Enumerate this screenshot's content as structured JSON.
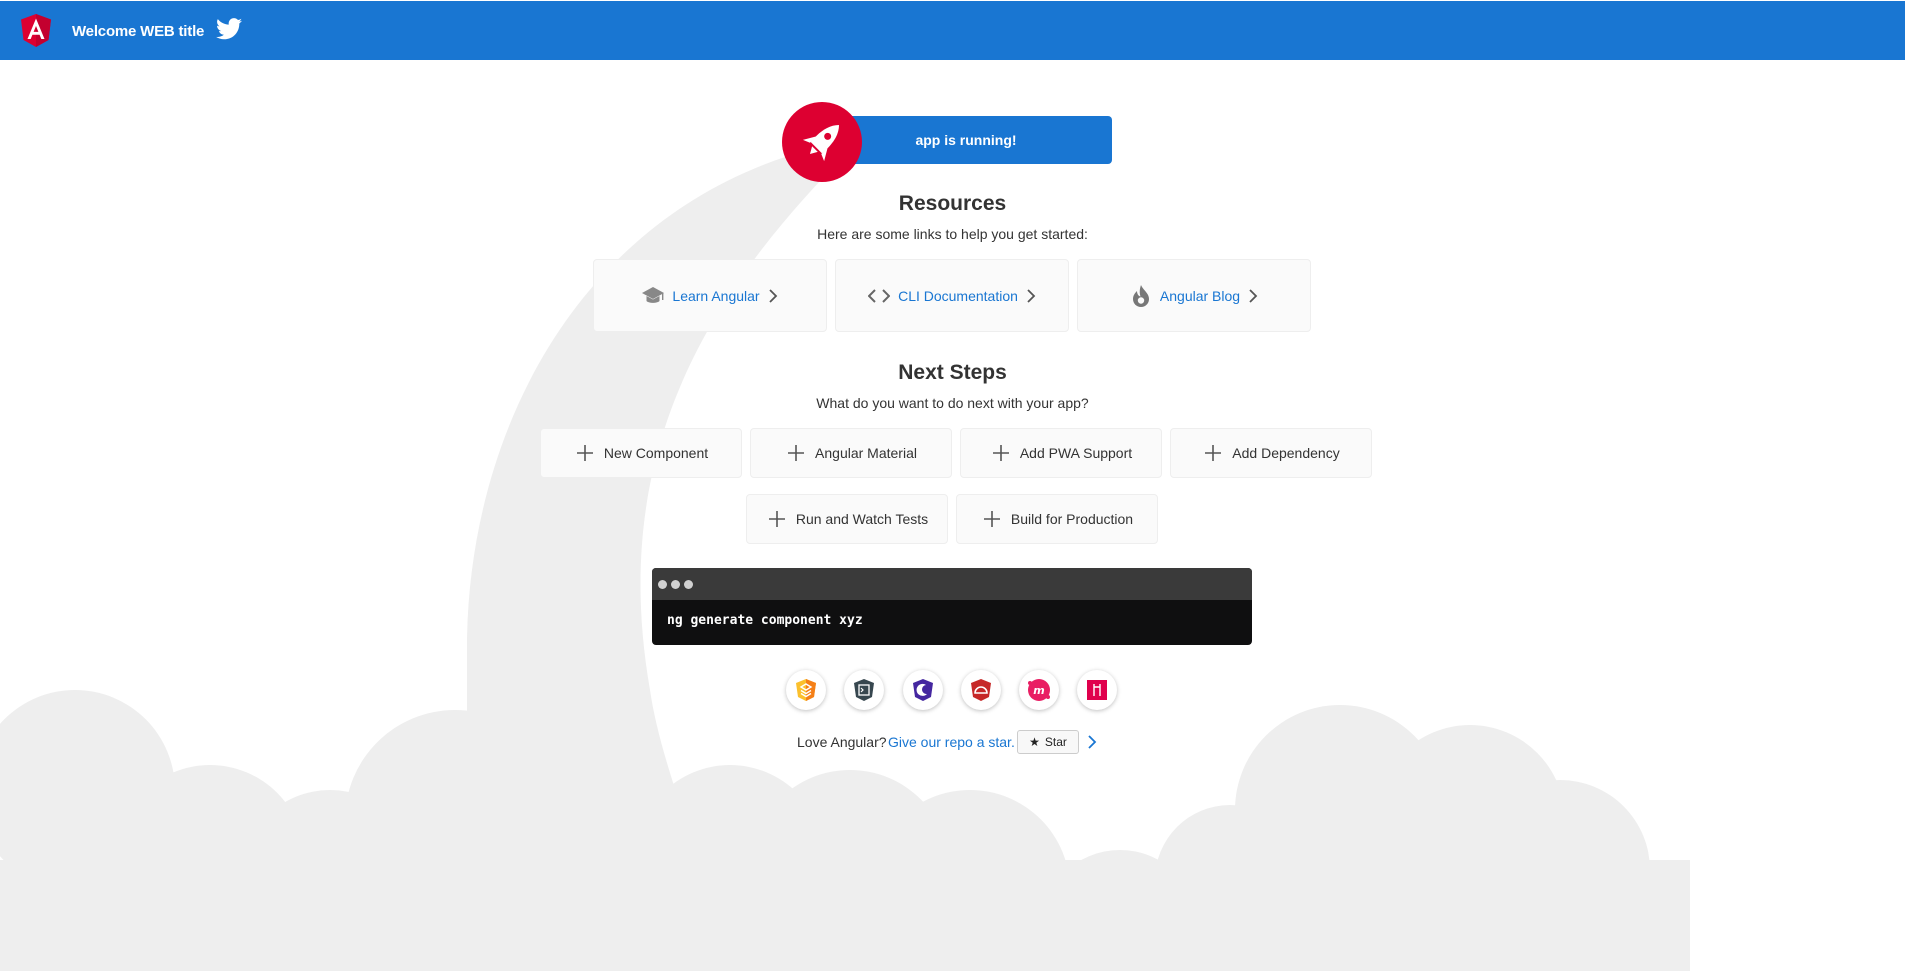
{
  "toolbar": {
    "title": "Welcome WEB title",
    "logo_icon": "angular-logo-icon",
    "social_icon": "twitter-icon",
    "background_color": "#1976d2"
  },
  "hero": {
    "badge_icon": "rocket-icon",
    "running_text": "app is running!",
    "accent_color": "#dd0031"
  },
  "resources": {
    "heading": "Resources",
    "subtitle": "Here are some links to help you get started:",
    "cards": [
      {
        "label": "Learn Angular",
        "icon": "graduation-cap-icon"
      },
      {
        "label": "CLI Documentation",
        "icon": "code-brackets-icon"
      },
      {
        "label": "Angular Blog",
        "icon": "flame-icon"
      }
    ]
  },
  "next_steps": {
    "heading": "Next Steps",
    "subtitle": "What do you want to do next with your app?",
    "actions": [
      {
        "label": "New Component",
        "icon": "plus-icon"
      },
      {
        "label": "Angular Material",
        "icon": "plus-icon"
      },
      {
        "label": "Add PWA Support",
        "icon": "plus-icon"
      },
      {
        "label": "Add Dependency",
        "icon": "plus-icon"
      },
      {
        "label": "Run and Watch Tests",
        "icon": "plus-icon"
      },
      {
        "label": "Build for Production",
        "icon": "plus-icon"
      }
    ]
  },
  "terminal": {
    "command": "ng generate component xyz"
  },
  "ecosystem_links": [
    {
      "icon": "animations-icon"
    },
    {
      "icon": "cli-icon"
    },
    {
      "icon": "augury-icon"
    },
    {
      "icon": "protractor-icon"
    },
    {
      "icon": "nest-icon"
    },
    {
      "icon": "ngrx-icon"
    }
  ],
  "footer": {
    "love_text": "Love Angular?",
    "star_link": "Give our repo a star.",
    "star_button": "Star",
    "star_icon": "star-icon",
    "more_icon": "chevron-right-icon"
  }
}
